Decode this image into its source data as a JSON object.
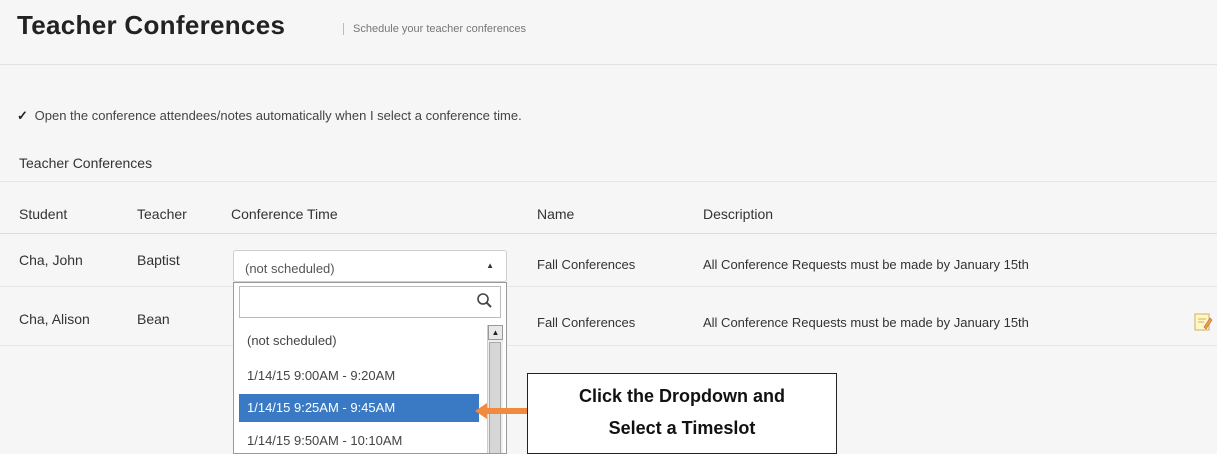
{
  "header": {
    "title": "Teacher Conferences",
    "subtitle": "Schedule your teacher conferences"
  },
  "options": {
    "auto_open_checked": true,
    "auto_open_label": "Open the conference attendees/notes automatically when I select a conference time."
  },
  "section": {
    "title": "Teacher Conferences"
  },
  "table": {
    "columns": [
      "Student",
      "Teacher",
      "Conference Time",
      "Name",
      "Description"
    ],
    "rows": [
      {
        "student": "Cha, John",
        "teacher": "Baptist",
        "conference_time": "(not scheduled)",
        "name": "Fall Conferences",
        "description": "All Conference Requests must be made by January 15th"
      },
      {
        "student": "Cha, Alison",
        "teacher": "Bean",
        "conference_time": "",
        "name": "Fall Conferences",
        "description": "All Conference Requests must be made by January 15th"
      }
    ]
  },
  "dropdown": {
    "search_placeholder": "",
    "options": [
      "(not scheduled)",
      "1/14/15 9:00AM - 9:20AM",
      "1/14/15 9:25AM - 9:45AM",
      "1/14/15 9:50AM - 10:10AM"
    ],
    "highlighted_index": 2
  },
  "callout": {
    "line1": "Click the Dropdown and",
    "line2": "Select a Timeslot"
  },
  "icons": {
    "checkmark": "check-icon",
    "search": "search-icon",
    "notes": "note-edit-icon",
    "arrow": "arrow-left-icon"
  },
  "colors": {
    "selected_option": "#3a7ac4",
    "arrow": "#f08a3e"
  }
}
